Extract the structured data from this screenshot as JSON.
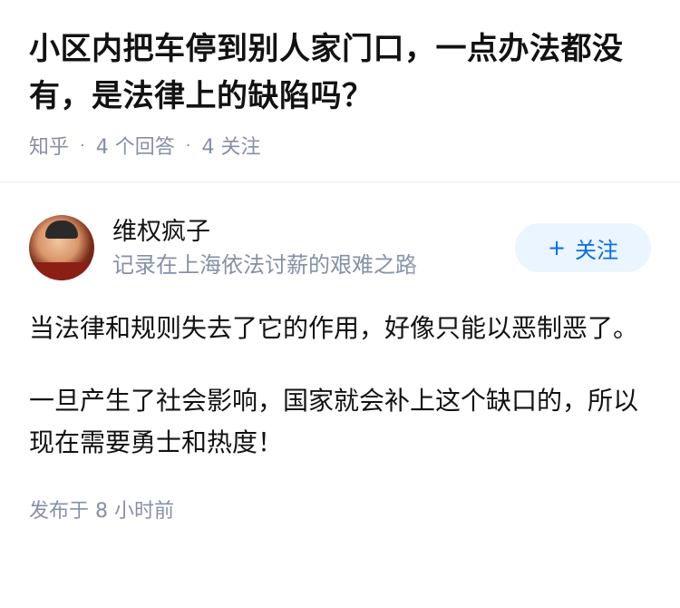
{
  "question": {
    "title": "小区内把车停到别人家门口，一点办法都没有，是法律上的缺陷吗？",
    "source": "知乎",
    "answer_count": "4 个回答",
    "follow_count": "4 关注"
  },
  "answer": {
    "author": {
      "name": "维权疯子",
      "bio": "记录在上海依法讨薪的艰难之路"
    },
    "follow_button": {
      "icon": "+",
      "label": "关注"
    },
    "paragraphs": [
      "当法律和规则失去了它的作用，好像只能以恶制恶了。",
      "一旦产生了社会影响，国家就会补上这个缺口的，所以现在需要勇士和热度！"
    ],
    "published": "发布于  8 小时前"
  }
}
